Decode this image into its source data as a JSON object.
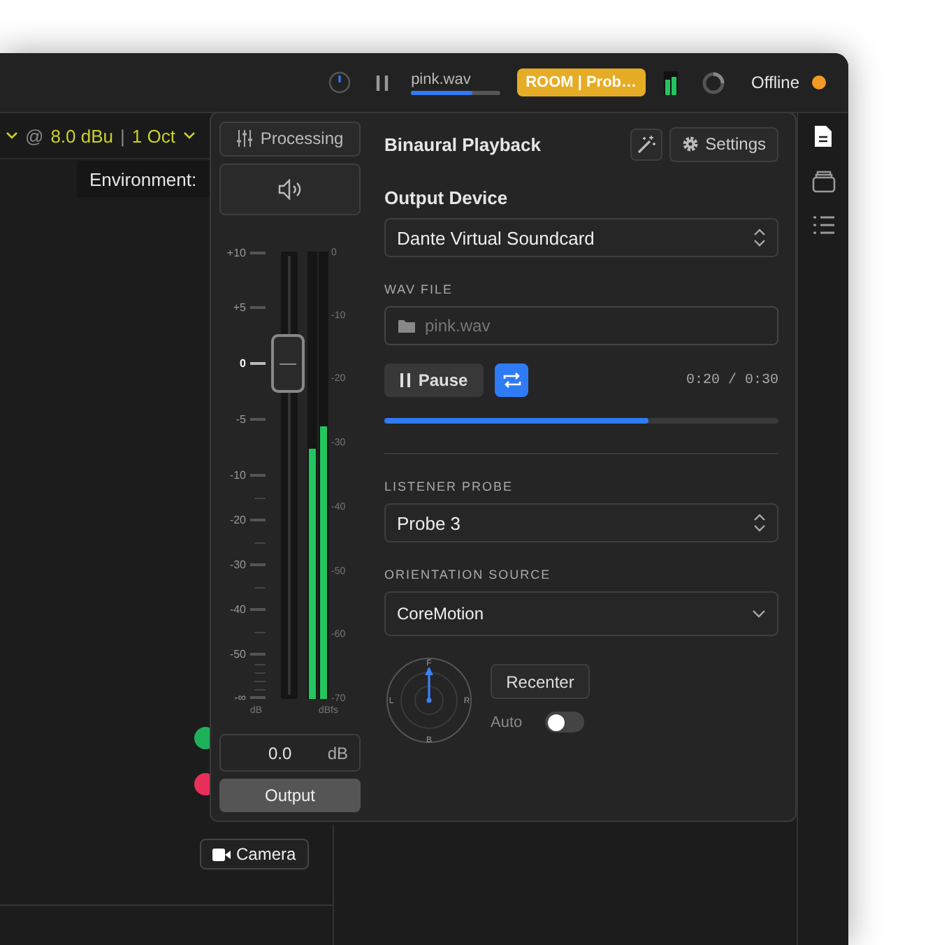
{
  "top_bar": {
    "now_playing": {
      "file": "pink.wav",
      "level": 0.69
    },
    "badge": "ROOM | Prob…",
    "status": {
      "label": "Offline",
      "color": "#f39a26"
    }
  },
  "toolbar": {
    "at": "@",
    "gain": "8.0 dBu",
    "separator": "|",
    "date": "1 Oct"
  },
  "environment_label": "Environment:",
  "indicators": [
    {
      "color": "#1fb15a"
    },
    {
      "color": "#e8305a"
    }
  ],
  "camera_button": "Camera",
  "sidebar": {
    "tabs": [
      {
        "kind": "document",
        "selected": true
      },
      {
        "kind": "stack",
        "selected": false
      },
      {
        "kind": "list",
        "selected": false
      }
    ]
  },
  "mixer": {
    "processing_button": "Processing",
    "scale": [
      {
        "label": "+10",
        "current": false
      },
      {
        "label": "+5",
        "current": false
      },
      {
        "label": "0",
        "current": true
      },
      {
        "label": "-5",
        "current": false
      },
      {
        "label": "-10",
        "current": false
      },
      {
        "label": "-20",
        "current": false
      },
      {
        "label": "-30",
        "current": false
      },
      {
        "label": "-40",
        "current": false
      },
      {
        "label": "-50",
        "current": false
      },
      {
        "label": "-∞",
        "current": false
      }
    ],
    "meter_scale": [
      "0",
      "-10",
      "-20",
      "-30",
      "-40",
      "-50",
      "-60",
      "-70"
    ],
    "units": [
      "dB",
      "dBfs"
    ],
    "fader": {
      "level": 0.75
    },
    "channels": [
      {
        "level": 0.56
      },
      {
        "level": 0.61
      }
    ],
    "gain_field": {
      "value": "0.0",
      "unit": "dB"
    },
    "output_button": "Output"
  },
  "playback": {
    "title": "Binaural Playback",
    "settings_button": "Settings",
    "output_device": {
      "label": "Output Device",
      "value": "Dante Virtual Soundcard",
      "kind": "popup"
    },
    "wav_file": {
      "label": "WAV FILE",
      "placeholder": "pink.wav"
    },
    "pause_button": "Pause",
    "loop": {
      "on": true
    },
    "time": "0:20 / 0:30",
    "progress": {
      "level": 0.67
    },
    "listener_probe": {
      "label": "LISTENER PROBE",
      "value": "Probe 3",
      "kind": "popup"
    },
    "orientation_source": {
      "label": "ORIENTATION SOURCE",
      "value": "CoreMotion",
      "kind": "dropdown"
    },
    "compass": {
      "labels": [
        "F",
        "L",
        "R",
        "B"
      ]
    },
    "recenter_button": "Recenter",
    "auto": {
      "label": "Auto",
      "on": false
    }
  }
}
